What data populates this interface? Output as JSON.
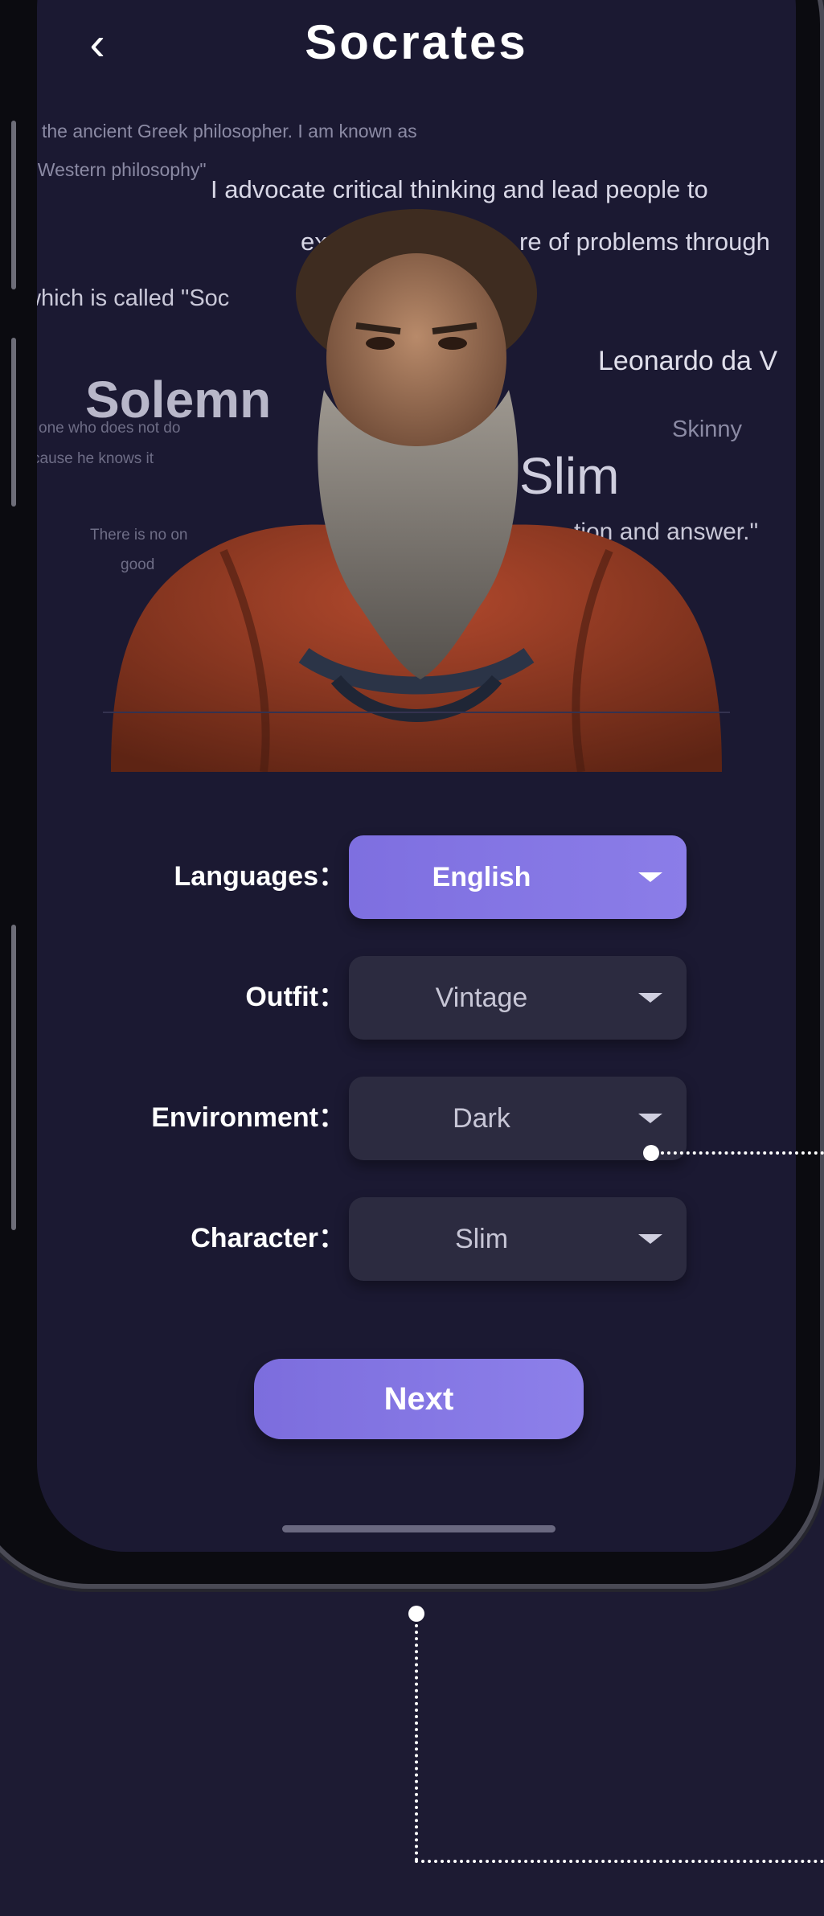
{
  "header": {
    "title": "Socrates",
    "back_icon": "chevron-left-icon"
  },
  "word_cloud": {
    "line1": "the ancient Greek philosopher. I am known as",
    "line2": "f Western philosophy\"",
    "line3": "I advocate critical thinking and lead people to",
    "line4a": "ex",
    "line4b": "re of problems through",
    "line5": "which is called \"Soc",
    "word_leonardo": "Leonardo da V",
    "word_solemn": "Solemn",
    "word_skinny": "Skinny",
    "small1": "one who does not do",
    "small2": "cause he knows it",
    "word_slim": "Slim",
    "line_answer": "tion and answer.\"",
    "small3": "There is no on",
    "small4": "good"
  },
  "form": {
    "languages": {
      "label": "Languages：",
      "value": "English"
    },
    "outfit": {
      "label": "Outfit：",
      "value": "Vintage"
    },
    "environment": {
      "label": "Environment：",
      "value": "Dark"
    },
    "character": {
      "label": "Character：",
      "value": "Slim"
    }
  },
  "next_button": "Next",
  "colors": {
    "background": "#1d1b33",
    "screen": "#1b1932",
    "accent": "#8577e6",
    "select_bg": "#2c2b40"
  }
}
